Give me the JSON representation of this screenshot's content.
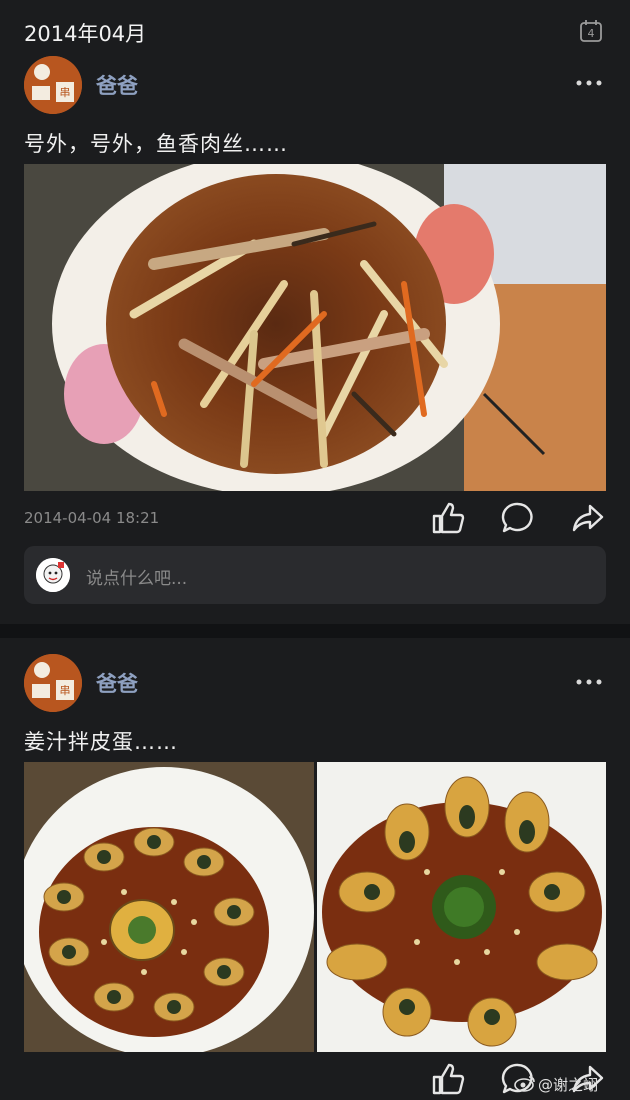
{
  "header": {
    "month": "2014年04月",
    "calendar_day": "4"
  },
  "posts": [
    {
      "username": "爸爸",
      "text": "号外，号外，鱼香肉丝……",
      "timestamp": "2014-04-04 18:21",
      "comment_placeholder": "说点什么吧..."
    },
    {
      "username": "爸爸",
      "text": "姜汁拌皮蛋……"
    }
  ],
  "watermark": "@谢之翊",
  "colors": {
    "background": "#1b1c1e",
    "username": "#8ea0c0",
    "card": "#2a2b2e"
  },
  "icons": [
    "calendar-icon",
    "more-icon",
    "like-icon",
    "comment-icon",
    "share-icon",
    "weibo-icon"
  ]
}
